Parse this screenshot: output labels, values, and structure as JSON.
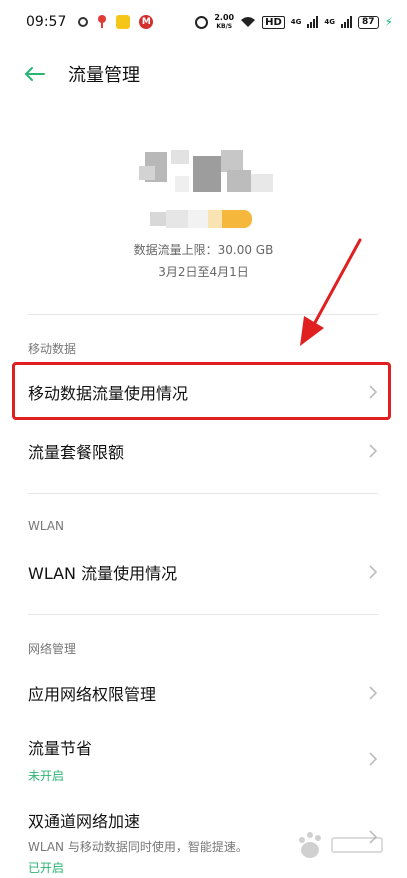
{
  "status_bar": {
    "time": "09:57",
    "speed_value": "2.00",
    "speed_unit": "KB/S",
    "hd_label": "HD",
    "net_label": "4G",
    "battery": "87"
  },
  "header": {
    "title": "流量管理"
  },
  "summary": {
    "limit_text": "数据流量上限：30.00 GB",
    "period_text": "3月2日至4月1日"
  },
  "sections": {
    "mobile_data": {
      "label": "移动数据",
      "items": [
        {
          "title": "移动数据流量使用情况"
        },
        {
          "title": "流量套餐限额"
        }
      ]
    },
    "wlan": {
      "label": "WLAN",
      "items": [
        {
          "title": "WLAN 流量使用情况"
        }
      ]
    },
    "network": {
      "label": "网络管理",
      "items": [
        {
          "title": "应用网络权限管理"
        },
        {
          "title": "流量节省",
          "subtitle": "未开启"
        },
        {
          "title": "双通道网络加速",
          "subtitle": "WLAN 与移动数据同时使用，智能提速。",
          "status": "已开启"
        }
      ]
    }
  },
  "colors": {
    "accent_green": "#2bb573",
    "highlight_red": "#e02020",
    "usage_bar_yellow": "#f5b83d"
  }
}
